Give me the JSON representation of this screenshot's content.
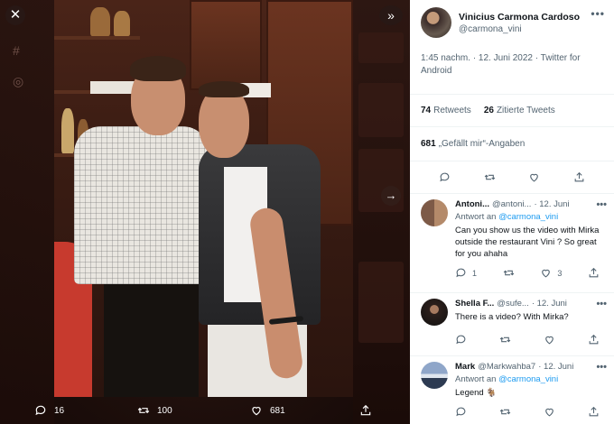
{
  "viewer": {
    "close_icon": "close-icon",
    "expand_icon": "chevrons-right-icon",
    "next_icon": "arrow-right-icon",
    "actions": {
      "replies": "16",
      "retweets": "100",
      "likes": "681"
    }
  },
  "tweet": {
    "author": {
      "name": "Vinicius Carmona Cardoso",
      "handle": "@carmona_vini"
    },
    "timestamp": "1:45 nachm. · 12. Juni 2022 · Twitter for Android",
    "retweets_count": "74",
    "retweets_label": "Retweets",
    "quotes_count": "26",
    "quotes_label": "Zitierte Tweets",
    "likes_count": "681",
    "likes_label": "„Gefällt mir“-Angaben",
    "more_label": "•••"
  },
  "replies": [
    {
      "name": "Antoni...",
      "handle": "@antoni...",
      "time": "· 12. Juni",
      "replying_prefix": "Antwort an",
      "replying_to": "@carmona_vini",
      "text": "Can you show us the video with Mirka outside the restaurant Vini ? So great for you ahaha",
      "reply_count": "1",
      "retweet_count": "",
      "like_count": "3"
    },
    {
      "name": "Shella F...",
      "handle": "@sufe...",
      "time": "· 12. Juni",
      "text": "There is a video? With Mirka?",
      "reply_count": "",
      "retweet_count": "",
      "like_count": ""
    },
    {
      "name": "Mark",
      "handle": "@Markwahba7",
      "time": "· 12. Juni",
      "replying_prefix": "Antwort an",
      "replying_to": "@carmona_vini",
      "text": "Legend 🐐",
      "reply_count": "",
      "retweet_count": "",
      "like_count": ""
    }
  ]
}
